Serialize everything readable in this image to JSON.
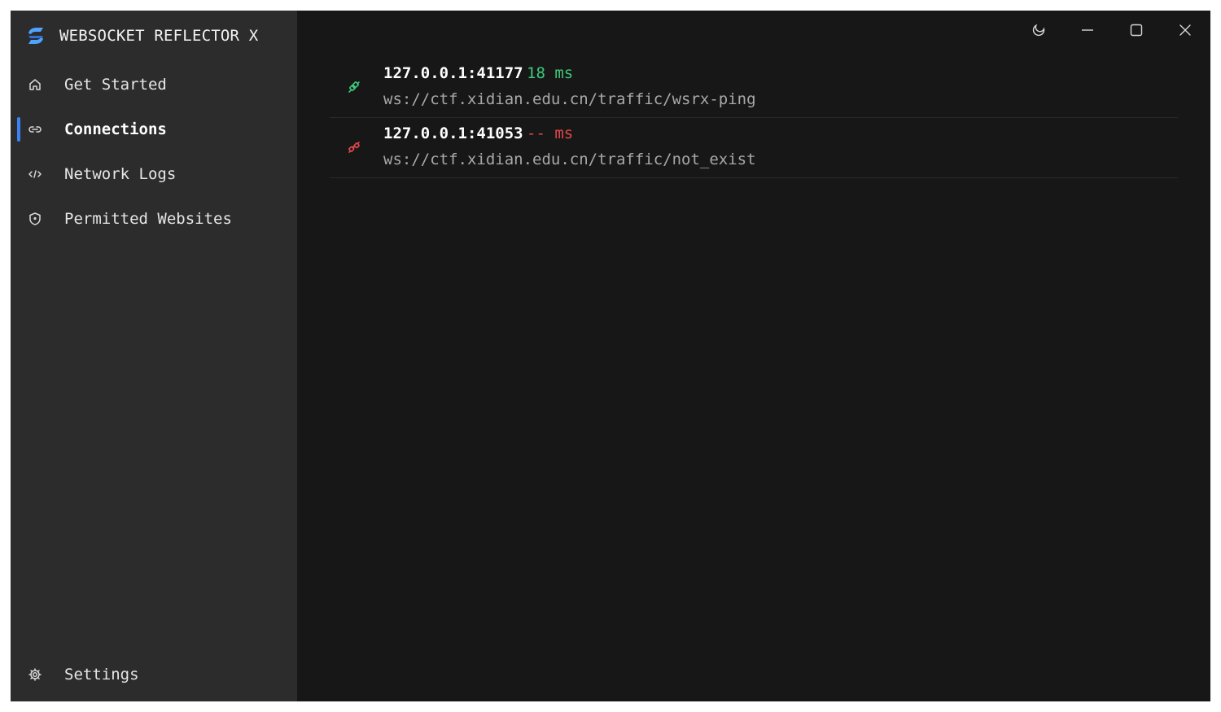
{
  "app": {
    "title": "WEBSOCKET REFLECTOR X",
    "logo_icon": "websocket-reflector-logo"
  },
  "sidebar": {
    "items": [
      {
        "label": "Get Started",
        "icon": "home-icon",
        "active": false
      },
      {
        "label": "Connections",
        "icon": "link-icon",
        "active": true
      },
      {
        "label": "Network Logs",
        "icon": "code-icon",
        "active": false
      },
      {
        "label": "Permitted Websites",
        "icon": "shield-icon",
        "active": false
      }
    ],
    "footer": {
      "label": "Settings",
      "icon": "gear-icon"
    }
  },
  "titlebar": {
    "buttons": [
      "theme-toggle-icon",
      "minimize-icon",
      "maximize-icon",
      "close-icon"
    ]
  },
  "connections": [
    {
      "address": "127.0.0.1:41177",
      "latency": "18 ms",
      "url": "ws://ctf.xidian.edu.cn/traffic/wsrx-ping",
      "status": "connected",
      "color": "#3ec97a"
    },
    {
      "address": "127.0.0.1:41053",
      "latency": "-- ms",
      "url": "ws://ctf.xidian.edu.cn/traffic/not_exist",
      "status": "disconnected",
      "color": "#e5484d"
    }
  ],
  "colors": {
    "accent": "#3b82f6",
    "sidebar_bg": "#2c2c2c",
    "main_bg": "#171717"
  }
}
